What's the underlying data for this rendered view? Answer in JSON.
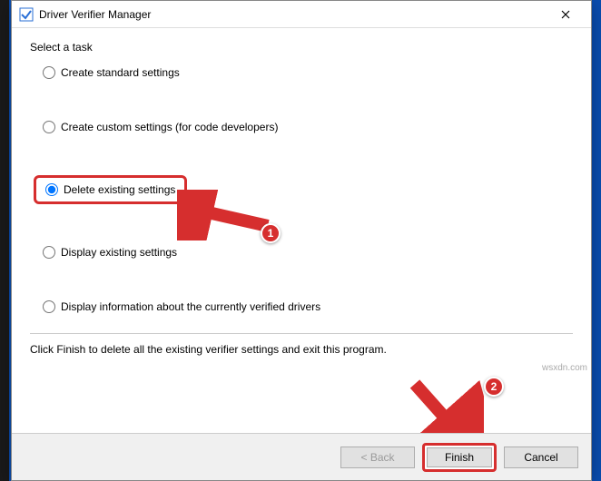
{
  "window": {
    "title": "Driver Verifier Manager"
  },
  "task_label": "Select a task",
  "options": {
    "create_standard": "Create standard settings",
    "create_custom": "Create custom settings (for code developers)",
    "delete_existing": "Delete existing settings",
    "display_existing": "Display existing settings",
    "display_info": "Display information about the currently verified drivers"
  },
  "instruction": "Click Finish to delete all the existing verifier settings and exit this program.",
  "buttons": {
    "back": "< Back",
    "finish": "Finish",
    "cancel": "Cancel"
  },
  "badges": {
    "one": "1",
    "two": "2"
  },
  "watermark": "wsxdn.com"
}
